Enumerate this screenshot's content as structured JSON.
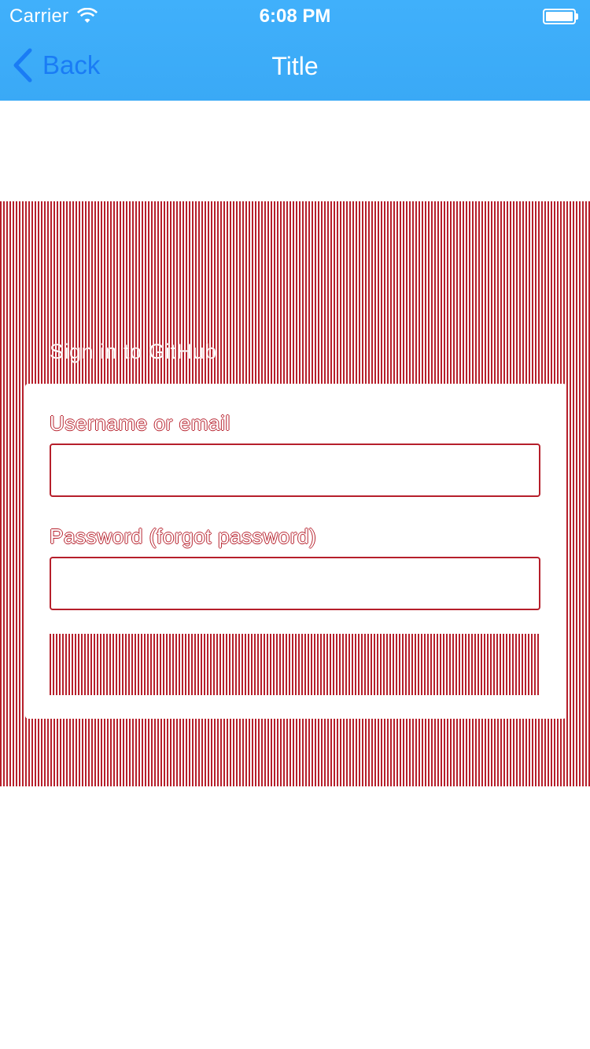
{
  "status_bar": {
    "carrier": "Carrier",
    "wifi_icon": "wifi-icon",
    "time": "6:08 PM",
    "battery_icon": "battery-icon",
    "battery_level": 1.0
  },
  "nav_bar": {
    "back_label": "Back",
    "back_icon": "chevron-left-icon",
    "title": "Title",
    "background_color": "#3daef8",
    "back_color": "#1a7cf5"
  },
  "signin": {
    "heading": "Sign in to GitHub",
    "username_label": "Username or email",
    "username_value": "",
    "password_label": "Password (forgot password)",
    "password_value": "",
    "panel_color": "#b61f2b"
  }
}
